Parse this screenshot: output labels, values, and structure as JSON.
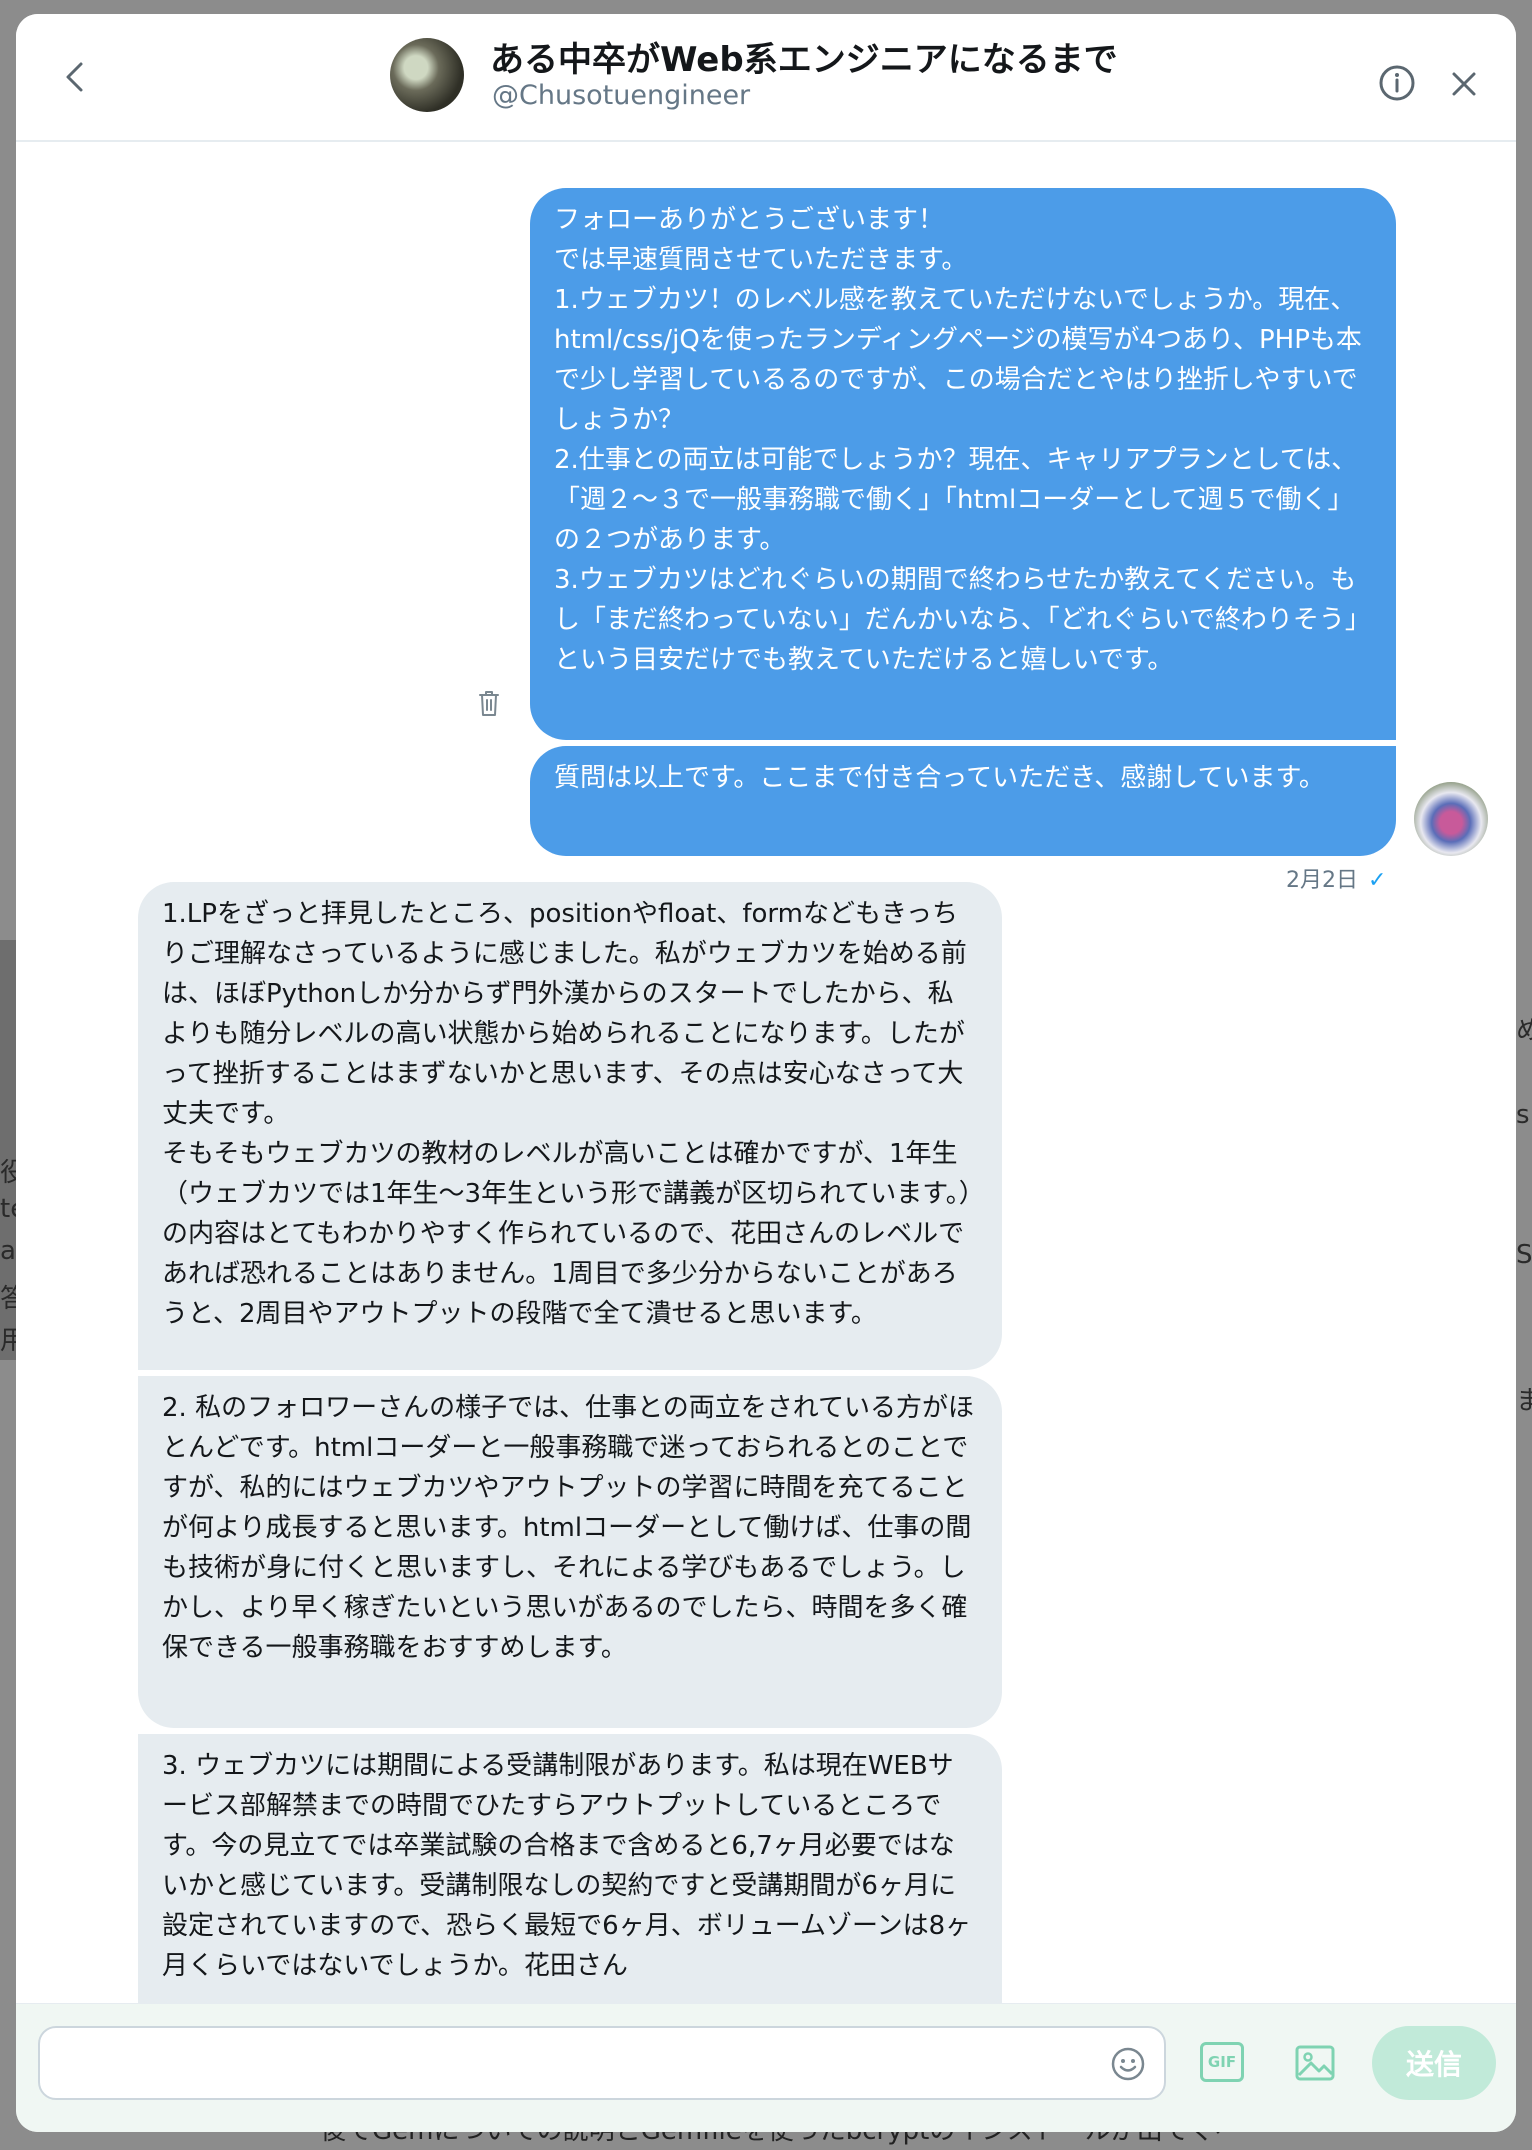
{
  "header": {
    "title": "ある中卒がWeb系エンジニアになるまで",
    "handle": "@Chusotuengineer"
  },
  "messages": {
    "sent": [
      "フォローありがとうございます！\nでは早速質問させていただきます。\n1.ウェブカツ！のレベル感を教えていただけないでしょうか。現在、html/css/jQを使ったランディングページの模写が4つあり、PHPも本で少し学習しているるのですが、この場合だとやはり挫折しやすいでしょうか？\n2.仕事との両立は可能でしょうか？現在、キャリアプランとしては、「週２〜３で一般事務職で働く」「htmlコーダーとして週５で働く」の２つがあります。\n3.ウェブカツはどれぐらいの期間で終わらせたか教えてください。もし「まだ終わっていない」だんかいなら、「どれぐらいで終わりそう」という目安だけでも教えていただけると嬉しいです。",
      "質問は以上です。ここまで付き合っていただき、感謝しています。"
    ],
    "timestamp": "2月2日",
    "read_mark": "✓",
    "received": [
      "1.LPをざっと拝見したところ、positionやfloat、formなどもきっちりご理解なさっているように感じました。私がウェブカツを始める前は、ほぼPythonしか分からず門外漢からのスタートでしたから、私よりも随分レベルの高い状態から始められることになります。したがって挫折することはまずないかと思います、その点は安心なさって大丈夫です。\nそもそもウェブカツの教材のレベルが高いことは確かですが、1年生（ウェブカツでは1年生〜3年生という形で講義が区切られています。）の内容はとてもわかりやすく作られているので、花田さんのレベルであれば恐れることはありません。1周目で多少分からないことがあろうと、2周目やアウトプットの段階で全て潰せると思います。",
      "2. 私のフォロワーさんの様子では、仕事との両立をされている方がほとんどです。htmlコーダーと一般事務職で迷っておられるとのことですが、私的にはウェブカツやアウトプットの学習に時間を充てることが何より成長すると思います。htmlコーダーとして働けば、仕事の間も技術が身に付くと思いますし、それによる学びもあるでしょう。しかし、より早く稼ぎたいという思いがあるのでしたら、時間を多く確保できる一般事務職をおすすめします。",
      "3. ウェブカツには期間による受講制限があります。私は現在WEBサービス部解禁までの時間でひたすらアウトプットしているところです。今の見立てでは卒業試験の合格まで含めると6,7ヶ月必要ではないかと感じています。受講制限なしの契約ですと受講期間が6ヶ月に設定されていますので、恐らく最短で6ヶ月、ボリュームゾーンは8ヶ月くらいではないでしょうか。花田さん"
    ]
  },
  "composer": {
    "placeholder": "",
    "gif_label": "GIF",
    "send_label": "送信"
  },
  "background": {
    "bottom_text": "後でGemについての説明とGemfileを使ったbcryptのインストールが出てくる。",
    "left_fragments": [
      "役",
      "te",
      "at",
      "答",
      "用"
    ],
    "right_fragments": [
      "め",
      "s",
      "S",
      "ま"
    ]
  },
  "colors": {
    "sent_bubble": "#4c9ce8",
    "received_bubble": "#e6ecf0",
    "send_button": "#c1ead9",
    "gif_accent": "#7fd3b2",
    "read_check": "#1da1f2"
  },
  "icons": {
    "back": "chevron-left-icon",
    "info": "info-icon",
    "close": "close-icon",
    "delete": "trash-icon",
    "emoji": "emoji-icon",
    "gif": "gif-icon",
    "image": "image-icon"
  }
}
